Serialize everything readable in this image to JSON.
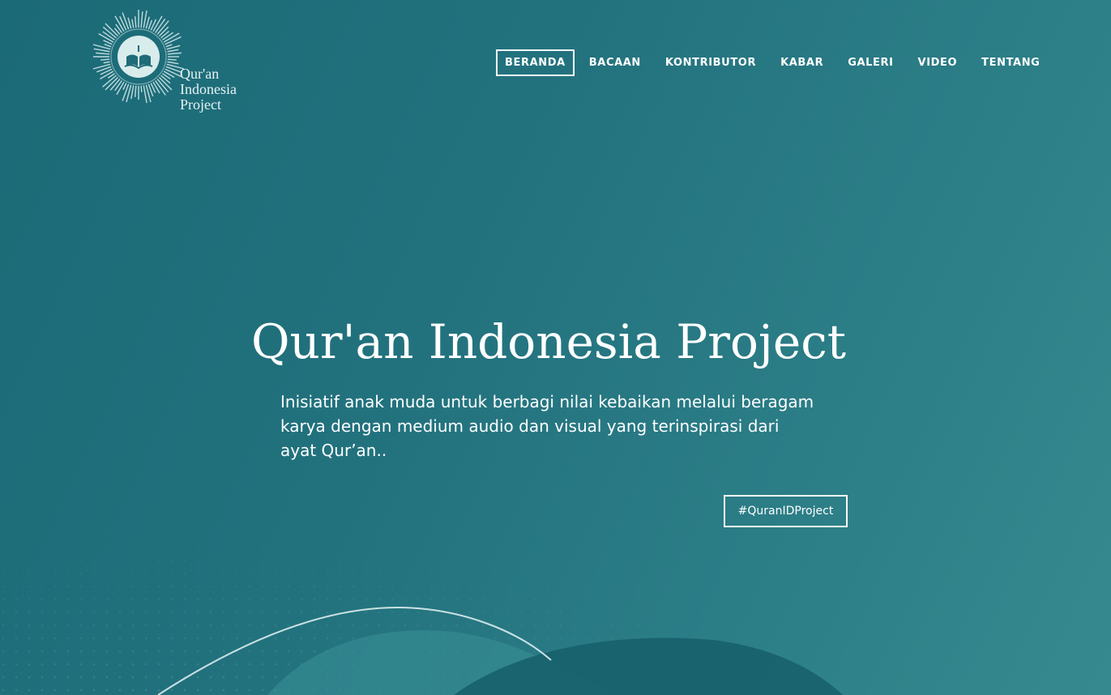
{
  "logo": {
    "lines": [
      "Qur'an",
      "Indonesia",
      "Project"
    ]
  },
  "nav": {
    "items": [
      {
        "label": "BERANDA",
        "active": true
      },
      {
        "label": "BACAAN"
      },
      {
        "label": "KONTRIBUTOR"
      },
      {
        "label": "KABAR"
      },
      {
        "label": "GALERI"
      },
      {
        "label": "VIDEO"
      },
      {
        "label": "TENTANG"
      }
    ]
  },
  "hero": {
    "title": "Qur'an Indonesia Project",
    "subtitle": "Inisiatif anak muda untuk berbagi nilai kebaikan melalui beragam karya dengan medium audio dan visual yang terinspirasi dari ayat Qur’an..",
    "hashtag": "#QuranIDProject"
  },
  "colors": {
    "background_start": "#1b6a77",
    "background_end": "#368a8f",
    "text": "#ffffff"
  },
  "icons": {
    "logo": "open-book-sunburst-icon"
  }
}
